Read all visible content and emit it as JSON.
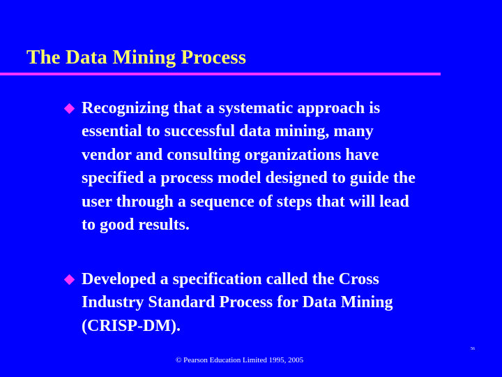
{
  "slide": {
    "title": "The Data Mining Process",
    "colors": {
      "background": "#0000FF",
      "title": "#FFFF66",
      "accent": "#FF33FF",
      "body_text": "#FFFFFF"
    },
    "bullet_icon": "diamond-icon",
    "bullets": [
      {
        "lines": [
          "Recognizing that a systematic approach is",
          "essential to successful data mining, many",
          "vendor and consulting organizations have",
          "specified a process model designed to guide the",
          "user through a sequence of steps that will lead",
          "to good results."
        ]
      },
      {
        "lines": [
          "Developed a specification called the Cross",
          "Industry Standard Process for Data Mining",
          "(CRISP-DM)."
        ]
      }
    ],
    "footer": "© Pearson Education Limited 1995, 2005",
    "slide_number": "56"
  }
}
